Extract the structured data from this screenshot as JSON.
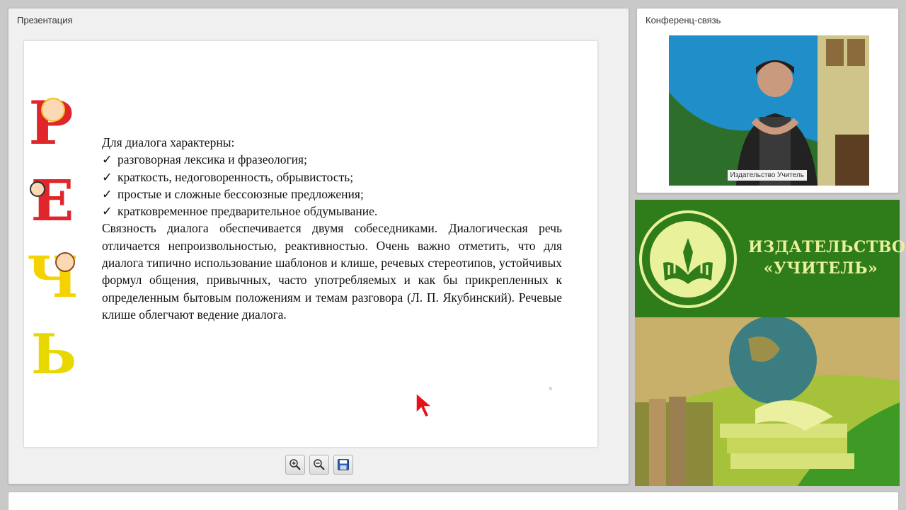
{
  "presentation": {
    "title": "Презентация",
    "slide": {
      "intro": "Для диалога характерны:",
      "bullet_mark": "✓",
      "bullets": [
        "разговорная лексика и фразеология;",
        "краткость, недоговоренность, обрывистость;",
        "простые и сложные бессоюзные предложения;",
        "кратковременное предварительное обдумывание."
      ],
      "paragraph": "Связность диалога обеспечивается двумя собеседниками. Диалогическая речь отличается непроизвольностью, реактивностью. Очень важно отметить, что для диалога типично использование шаблонов и клише, речевых стереотипов, устойчивых формул общения, привычных, часто употребляемых и как бы прикрепленных к определенным бытовым положениям и темам разговора (Л. П. Якубинский). Речевые клише облегчают ведение диалога.",
      "page_number": "6",
      "side_letters": [
        "Р",
        "Е",
        "Ч",
        "Ь"
      ]
    },
    "toolbar": {
      "zoom_in_icon": "zoom-in-icon",
      "zoom_out_icon": "zoom-out-icon",
      "save_icon": "save-icon"
    }
  },
  "conference": {
    "title": "Конференц-связь",
    "participant_name": "Издательство Учитель"
  },
  "publisher": {
    "line1": "ИЗДАТЕЛЬСТВО",
    "line2": "«УЧИТЕЛЬ»",
    "colors": {
      "green": "#2f7c1b",
      "light": "#e9f19b"
    }
  }
}
